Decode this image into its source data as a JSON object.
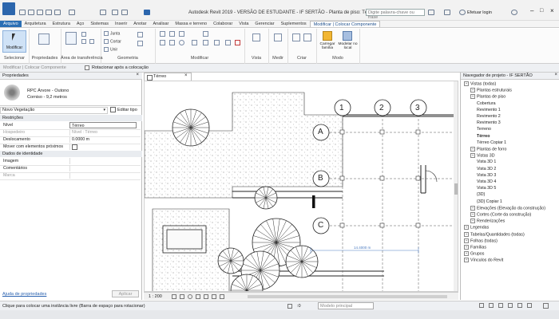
{
  "titlebar": {
    "title": "Autodesk Revit 2019 - VERSÃO DE ESTUDANTE - IF SERTÃO - Planta de piso: Térreo",
    "search_placeholder": "Digite palavra-chave ou frase",
    "login": "Efetuar login"
  },
  "tabs": [
    "Arquivo",
    "Arquitetura",
    "Estrutura",
    "Aço",
    "Sistemas",
    "Inserir",
    "Anotar",
    "Analisar",
    "Massa e terreno",
    "Colaborar",
    "Vista",
    "Gerenciar",
    "Suplementos",
    "Modificar | Colocar Componente"
  ],
  "ribbon": {
    "modify_label": "Modificar",
    "join_label": "Junta",
    "cut_label": "Cortar",
    "unite_label": "Unir",
    "load_family_label": "Carregar família",
    "model_inplace_label": "Modelar no local",
    "groups": [
      "Selecionar",
      "Propriedades",
      "Área de transferência",
      "Geometria",
      "Modificar",
      "Vista",
      "Medir",
      "Criar",
      "Modo"
    ]
  },
  "optionsbar": {
    "context": "Modificar | Colocar Componente",
    "rotate_label": "Rotacionar após a colocação"
  },
  "properties": {
    "header": "Propriedades",
    "family_name": "RPC Árvore - Outono",
    "family_type": "Corniso - 9,2 metros",
    "selector": "Novo Vegetação",
    "edit_type": "Editar tipo",
    "sections": [
      {
        "title": "Restrições",
        "rows": [
          {
            "key": "Nível",
            "value": "Térreo"
          },
          {
            "key": "Hospedeiro",
            "value": "Nível : Térreo"
          },
          {
            "key": "Deslocamento",
            "value": "0.0000 m"
          },
          {
            "key": "Mover com elementos próximos",
            "value": ""
          }
        ]
      },
      {
        "title": "Dados de identidade",
        "rows": [
          {
            "key": "Imagem",
            "value": ""
          },
          {
            "key": "Comentários",
            "value": ""
          },
          {
            "key": "Marca",
            "value": ""
          }
        ]
      }
    ],
    "help_link": "Ajuda de propriedades",
    "apply_button": "Aplicar"
  },
  "view": {
    "tab_label": "Térreo",
    "grid_labels_numbers": [
      "1",
      "2",
      "3"
    ],
    "grid_labels_letters": [
      "A",
      "B",
      "C"
    ],
    "dimension_text": "14.4000 m",
    "scale": "1 : 200"
  },
  "browser": {
    "header": "Navegador de projeto - IF SERTÃO",
    "nodes": [
      {
        "label": "Vistas (todas)",
        "level": 0
      },
      {
        "label": "Plantas estruturais",
        "level": 1
      },
      {
        "label": "Plantas de piso",
        "level": 1
      },
      {
        "label": "Cobertura",
        "level": 2
      },
      {
        "label": "Revimento 1",
        "level": 2
      },
      {
        "label": "Revimento 2",
        "level": 2
      },
      {
        "label": "Revimento 3",
        "level": 2
      },
      {
        "label": "Terreno",
        "level": 2
      },
      {
        "label": "Térreo",
        "level": 2,
        "bold": true
      },
      {
        "label": "Térreo Copiar 1",
        "level": 2
      },
      {
        "label": "Plantas de forro",
        "level": 1
      },
      {
        "label": "Vistas 3D",
        "level": 1
      },
      {
        "label": "Vista 3D 1",
        "level": 2
      },
      {
        "label": "Vista 3D 2",
        "level": 2
      },
      {
        "label": "Vista 3D 3",
        "level": 2
      },
      {
        "label": "Vista 3D 4",
        "level": 2
      },
      {
        "label": "Vista 3D 5",
        "level": 2
      },
      {
        "label": "{3D}",
        "level": 2
      },
      {
        "label": "{3D} Copiar 1",
        "level": 2
      },
      {
        "label": "Elevações (Elevação da construção)",
        "level": 1
      },
      {
        "label": "Cortes (Corte da construção)",
        "level": 1
      },
      {
        "label": "Renderizações",
        "level": 1
      },
      {
        "label": "Legendas",
        "level": 0
      },
      {
        "label": "Tabelas/Quantidades (todas)",
        "level": 0
      },
      {
        "label": "Folhas (todas)",
        "level": 0
      },
      {
        "label": "Famílias",
        "level": 0
      },
      {
        "label": "Grupos",
        "level": 0
      },
      {
        "label": "Vínculos do Revit",
        "level": 0
      }
    ]
  },
  "status": {
    "message": "Clique para colocar uma instância livre (Barra de espaço para rotacionar)",
    "coord": ":0",
    "model_select": "Modelo principal"
  }
}
